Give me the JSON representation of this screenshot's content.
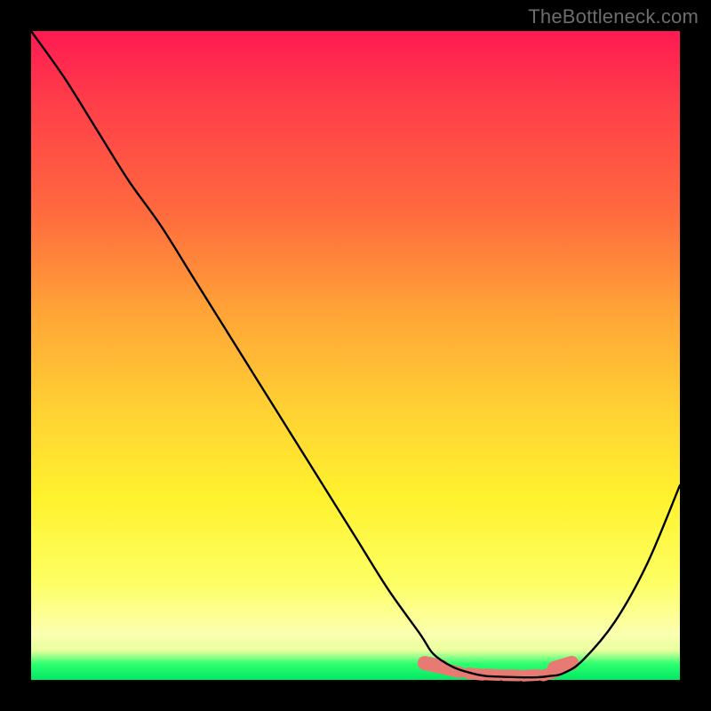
{
  "watermark": "TheBottleneck.com",
  "chart_data": {
    "type": "line",
    "title": "",
    "xlabel": "",
    "ylabel": "",
    "xlim": [
      0,
      100
    ],
    "ylim": [
      0,
      100
    ],
    "series": [
      {
        "name": "bottleneck-curve",
        "x": [
          0,
          5,
          10,
          15,
          20,
          25,
          30,
          35,
          40,
          45,
          50,
          55,
          60,
          62,
          65,
          68,
          70,
          72,
          75,
          78,
          80,
          82,
          85,
          90,
          95,
          100
        ],
        "y": [
          100,
          93,
          85,
          77,
          70,
          62,
          54,
          46,
          38,
          30,
          22,
          14,
          7,
          4,
          2,
          1,
          0.6,
          0.5,
          0.4,
          0.4,
          0.6,
          1,
          3,
          9,
          18,
          30
        ]
      }
    ],
    "optimal_zone": {
      "note": "salmon lozenges near curve bottom",
      "points_x": [
        62,
        65,
        68.5,
        71,
        74,
        77,
        80,
        82
      ],
      "points_y": [
        2.3,
        1.4,
        0.9,
        0.8,
        0.7,
        0.7,
        1.0,
        2.2
      ]
    },
    "colors": {
      "curve": "#000000",
      "lozenge": "#e77a72",
      "gradient_top": "#ff1a52",
      "gradient_bottom": "#00e865"
    }
  }
}
